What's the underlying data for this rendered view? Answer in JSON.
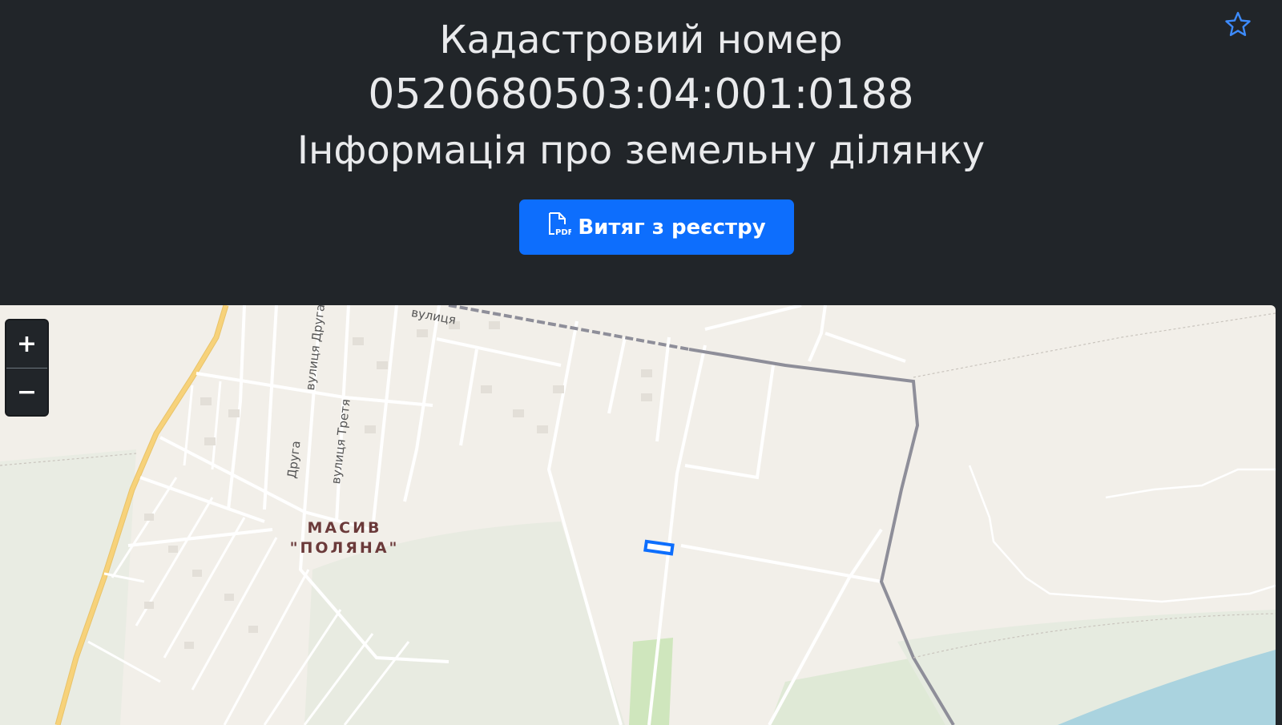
{
  "header": {
    "line1": "Кадастровий номер",
    "line2": "0520680503:04:001:0188",
    "line3": "Інформація про земельну ділянку",
    "favorite_icon": "star-icon",
    "extract_button": {
      "label": "Витяг з реєстру",
      "icon": "pdf-file-icon",
      "icon_text": "PDF"
    }
  },
  "map": {
    "zoom_in_label": "+",
    "zoom_out_label": "−",
    "place_label_line1": "МАСИВ",
    "place_label_line2": "\"ПОЛЯНА\"",
    "street_labels": {
      "druha_top": "вулиця Друга",
      "druha_bottom": "Друга",
      "tretia": "вулиця Третя",
      "top_fragment": "вулиця"
    },
    "colors": {
      "background": "#f2efe9",
      "road": "#ffffff",
      "main_road": "#f7d27a",
      "boundary": "#8e8e99",
      "water": "#aad3df",
      "green": "#cfe6bd",
      "parcel_highlight": "#0d6efd"
    }
  },
  "colors": {
    "header_bg": "#212529",
    "header_text": "#e9eaec",
    "button_bg": "#0d6efd",
    "star": "#3d8bfd"
  }
}
